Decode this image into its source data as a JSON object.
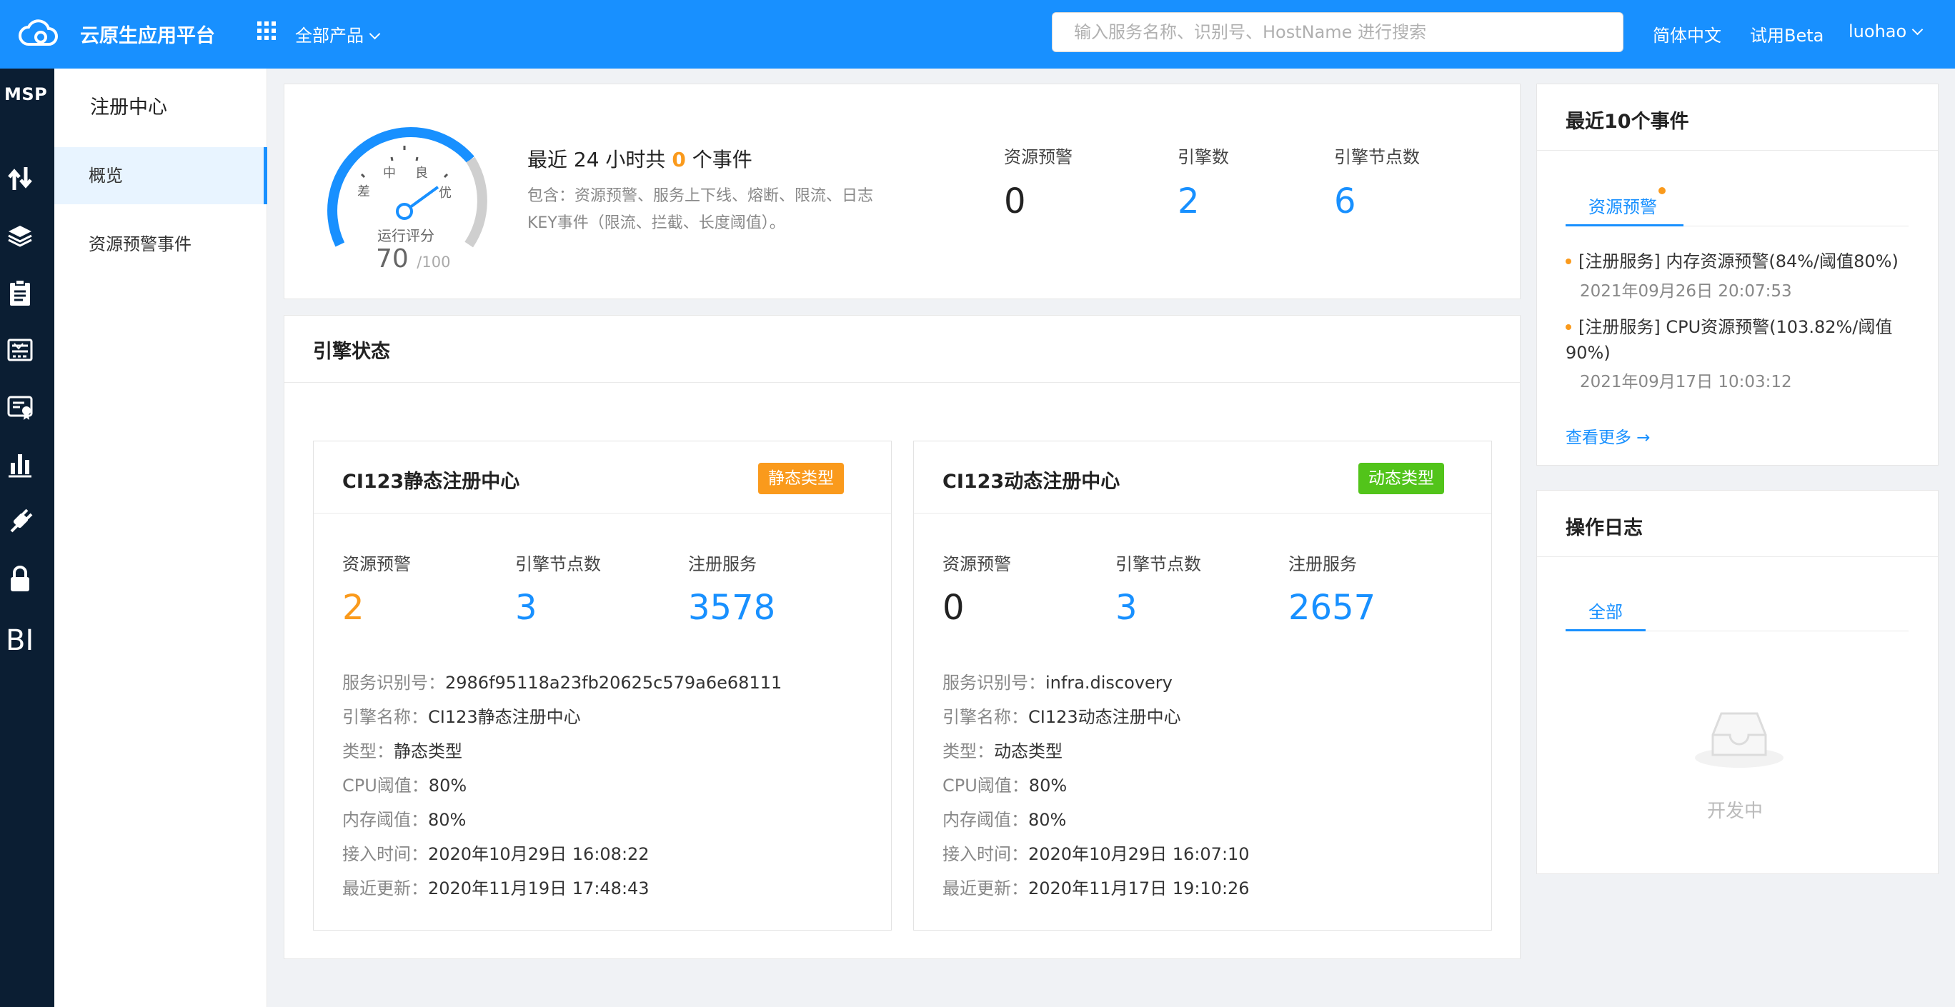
{
  "topbar": {
    "brand": "云原生应用平台",
    "products_label": "全部产品",
    "search_placeholder": "输入服务名称、识别号、HostName 进行搜索",
    "language": "简体中文",
    "beta": "试用Beta",
    "user": "luohao"
  },
  "rail": {
    "product": "MSP",
    "bi_label": "BI",
    "icons": [
      "transfer-icon",
      "layers-icon",
      "clipboard-icon",
      "monitor-icon",
      "certificate-icon",
      "bar-chart-icon",
      "plug-icon",
      "lock-icon"
    ]
  },
  "submenu": {
    "title": "注册中心",
    "items": [
      {
        "label": "概览",
        "active": true
      },
      {
        "label": "资源预警事件",
        "active": false
      }
    ]
  },
  "overview": {
    "gauge": {
      "labels": {
        "poor": "差",
        "medium": "中",
        "good": "良",
        "excellent": "优"
      },
      "caption": "运行评分",
      "score": "70",
      "max": "/100",
      "score_value": 70
    },
    "events_prefix": "最近 24 小时共",
    "events_count": "0",
    "events_suffix": "个事件",
    "events_desc": "包含：资源预警、服务上下线、熔断、限流、日志KEY事件（限流、拦截、长度阈值）。",
    "stats": [
      {
        "label": "资源预警",
        "value": "0"
      },
      {
        "label": "引擎数",
        "value": "2"
      },
      {
        "label": "引擎节点数",
        "value": "6"
      }
    ]
  },
  "engine_status": {
    "title": "引擎状态",
    "engines": [
      {
        "name": "CI123静态注册中心",
        "tag": "静态类型",
        "stats": [
          {
            "label": "资源预警",
            "value": "2"
          },
          {
            "label": "引擎节点数",
            "value": "3"
          },
          {
            "label": "注册服务",
            "value": "3578"
          }
        ],
        "details": [
          {
            "key": "服务识别号：",
            "value": "2986f95118a23fb20625c579a6e68111"
          },
          {
            "key": "引擎名称：",
            "value": "CI123静态注册中心"
          },
          {
            "key": "类型：",
            "value": "静态类型"
          },
          {
            "key": "CPU阈值：",
            "value": "80%"
          },
          {
            "key": "内存阈值：",
            "value": "80%"
          },
          {
            "key": "接入时间：",
            "value": "2020年10月29日 16:08:22"
          },
          {
            "key": "最近更新：",
            "value": "2020年11月19日 17:48:43"
          }
        ]
      },
      {
        "name": "CI123动态注册中心",
        "tag": "动态类型",
        "stats": [
          {
            "label": "资源预警",
            "value": "0"
          },
          {
            "label": "引擎节点数",
            "value": "3"
          },
          {
            "label": "注册服务",
            "value": "2657"
          }
        ],
        "details": [
          {
            "key": "服务识别号：",
            "value": "infra.discovery"
          },
          {
            "key": "引擎名称：",
            "value": "CI123动态注册中心"
          },
          {
            "key": "类型：",
            "value": "动态类型"
          },
          {
            "key": "CPU阈值：",
            "value": "80%"
          },
          {
            "key": "内存阈值：",
            "value": "80%"
          },
          {
            "key": "接入时间：",
            "value": "2020年10月29日 16:07:10"
          },
          {
            "key": "最近更新：",
            "value": "2020年11月17日 19:10:26"
          }
        ]
      }
    ]
  },
  "recent_events": {
    "title": "最近10个事件",
    "tab": "资源预警",
    "items": [
      {
        "text": "[注册服务] 内存资源预警(84%/阈值80%)",
        "time": "2021年09月26日 20:07:53"
      },
      {
        "text": "[注册服务] CPU资源预警(103.82%/阈值90%)",
        "time": "2021年09月17日 10:03:12"
      }
    ],
    "more": "查看更多 →"
  },
  "op_log": {
    "title": "操作日志",
    "tab": "全部",
    "empty": "开发中"
  },
  "colors": {
    "primary": "#1890ff",
    "warning": "#fa9a1c",
    "success": "#52c41a",
    "rail": "#0b1e33"
  }
}
